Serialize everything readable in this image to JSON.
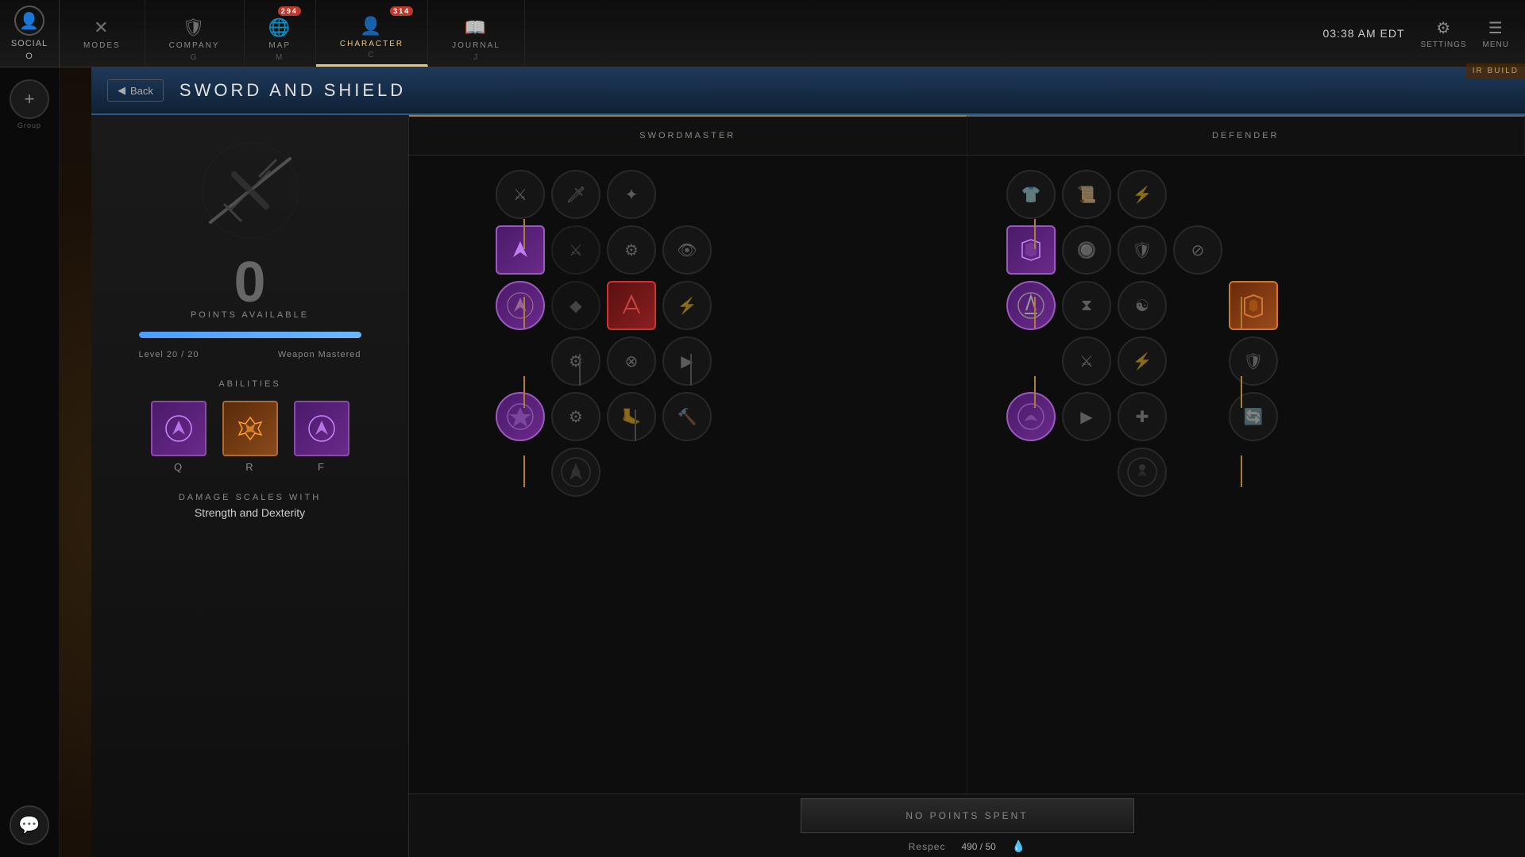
{
  "nav": {
    "social_label": "SOCIAL",
    "social_key": "O",
    "modes_label": "MODES",
    "company_label": "COMPANY",
    "company_key": "G",
    "map_label": "MAP",
    "map_key": "M",
    "map_badge": "294",
    "character_label": "CHARACTER",
    "character_key": "C",
    "character_badge": "314",
    "journal_label": "JOURNAL",
    "journal_key": "J",
    "time": "03:38 AM EDT",
    "settings_label": "SETTINGS",
    "menu_label": "MENU"
  },
  "watermark": "IR BUILD",
  "title_bar": {
    "back_label": "Back",
    "page_title": "SWORD AND SHIELD"
  },
  "left_panel": {
    "points_number": "0",
    "points_label": "POINTS AVAILABLE",
    "level_current": "20",
    "level_max": "20",
    "level_prefix": "Level",
    "weapon_mastered": "Weapon Mastered",
    "progress_pct": 100,
    "abilities_label": "ABILITIES",
    "abilities": [
      {
        "key": "Q",
        "type": "purple"
      },
      {
        "key": "R",
        "type": "orange"
      },
      {
        "key": "F",
        "type": "purple"
      }
    ],
    "damage_label": "DAMAGE SCALES WITH",
    "damage_value": "Strength and Dexterity"
  },
  "swordmaster": {
    "label": "SWORDMASTER"
  },
  "defender": {
    "label": "DEFENDER"
  },
  "bottom_bar": {
    "no_points_label": "NO POINTS SPENT",
    "respec_label": "Respec",
    "respec_value": "490 / 50"
  },
  "group_label": "Group"
}
